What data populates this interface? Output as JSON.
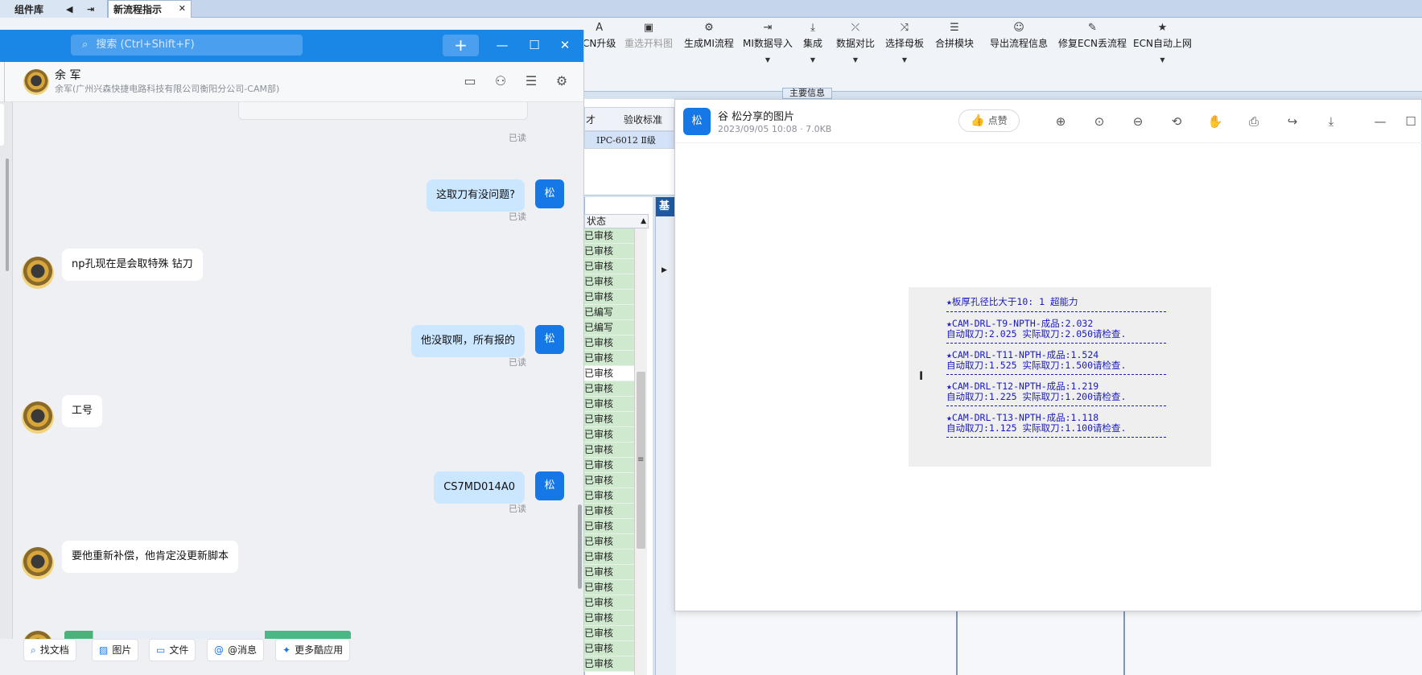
{
  "app": {
    "lib_tab": "组件库",
    "doc_tab": "新流程指示",
    "ribbon": [
      {
        "label": "CN升级",
        "icon": "A",
        "dropdown": false,
        "disabled": false
      },
      {
        "label": "重选开料图",
        "icon": "▣",
        "dropdown": false,
        "disabled": true
      },
      {
        "label": "生成MI流程",
        "icon": "⚙",
        "dropdown": false,
        "disabled": false
      },
      {
        "label": "MI数据导入",
        "icon": "⇥",
        "dropdown": true,
        "disabled": false
      },
      {
        "label": "集成",
        "icon": "⤓",
        "dropdown": true,
        "disabled": false
      },
      {
        "label": "数据对比",
        "icon": "⤫",
        "dropdown": true,
        "disabled": false
      },
      {
        "label": "选择母板",
        "icon": "⤨",
        "dropdown": true,
        "disabled": false
      },
      {
        "label": "合拼模块",
        "icon": "☰",
        "dropdown": false,
        "disabled": false
      },
      {
        "label": "导出流程信息",
        "icon": "☺",
        "dropdown": false,
        "disabled": false
      },
      {
        "label": "修复ECN丢流程",
        "icon": "✎",
        "dropdown": false,
        "disabled": false
      },
      {
        "label": "ECN自动上网",
        "icon": "★",
        "dropdown": true,
        "disabled": false
      }
    ],
    "main_info": "主要信息",
    "grid_header": {
      "col_a": "才",
      "col_b": "验收标准"
    },
    "grid_row": {
      "standard": "IPC-6012 Ⅱ级"
    },
    "side_tab": "基",
    "status_header": "状态",
    "status_rows": [
      "已审核",
      "已审核",
      "已审核",
      "已审核",
      "已审核",
      "已编写",
      "已编写",
      "已审核",
      "已审核",
      "已审核",
      "已审核",
      "已审核",
      "已审核",
      "已审核",
      "已审核",
      "已审核",
      "已审核",
      "已审核",
      "已审核",
      "已审核",
      "已审核",
      "已审核",
      "已审核",
      "已审核",
      "已审核",
      "已审核",
      "已审核",
      "已审核",
      "已审核"
    ],
    "status_white_index": 9
  },
  "chat": {
    "search_placeholder": "搜索 (Ctrl+Shift+F)",
    "contact_name": "余 军",
    "contact_org": "余军(广州兴森快捷电路科技有限公司衡阳分公司-CAM部)",
    "my_avatar_label": "松",
    "read_label": "已读",
    "messages": [
      {
        "from": "me",
        "text": "这取刀有没问题?"
      },
      {
        "from": "other",
        "text": "np孔现在是会取特殊 钻刀"
      },
      {
        "from": "me",
        "text": "他没取啊，所有报的"
      },
      {
        "from": "other",
        "text": "工号"
      },
      {
        "from": "me",
        "text": "CS7MD014A0"
      },
      {
        "from": "other",
        "text": "要他重新补偿，他肯定没更新脚本"
      }
    ],
    "tools": [
      {
        "label": "找文档",
        "icon": "⌕"
      },
      {
        "label": "图片",
        "icon": "▨"
      },
      {
        "label": "文件",
        "icon": "▭"
      },
      {
        "label": "@消息",
        "icon": "@"
      },
      {
        "label": "更多酷应用",
        "icon": "✦"
      }
    ]
  },
  "viewer": {
    "avatar_label": "松",
    "title": "谷 松分享的图片",
    "meta": "2023/09/05 10:08 · 7.0KB",
    "like_label": "点赞",
    "content_lines": [
      "★板厚孔径比大于10: 1 超能力",
      "★CAM-DRL-T9-NPTH-成品:2.032",
      "自动取刀:2.025 实际取刀:2.050请检查.",
      "★CAM-DRL-T11-NPTH-成品:1.524",
      "自动取刀:1.525 实际取刀:1.500请检查.",
      "★CAM-DRL-T12-NPTH-成品:1.219",
      "自动取刀:1.225 实际取刀:1.200请检查.",
      "★CAM-DRL-T13-NPTH-成品:1.118",
      "自动取刀:1.125 实际取刀:1.100请检查."
    ]
  },
  "colors": {
    "accent": "#1677e6",
    "chat_titlebar": "#1a86e6",
    "status_green": "#cfe9cf",
    "viewer_text": "#1a1abf"
  }
}
